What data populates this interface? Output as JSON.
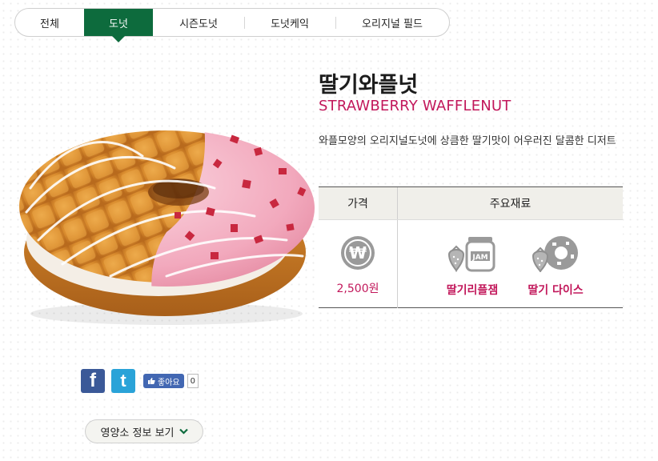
{
  "tabs": [
    {
      "label": "전체",
      "active": false
    },
    {
      "label": "도넛",
      "active": true
    },
    {
      "label": "시즌도넛",
      "active": false
    },
    {
      "label": "도넛케익",
      "active": false
    },
    {
      "label": "오리지널 필드",
      "active": false
    }
  ],
  "product": {
    "name_kr": "딸기와플넛",
    "name_en": "STRAWBERRY WAFFLENUT",
    "description": "와플모양의 오리지널도넛에 상큼한 딸기맛이 어우러진 달콤한 디저트"
  },
  "table": {
    "price_header": "가격",
    "ingredients_header": "주요재료",
    "price": "2,500원",
    "price_icon_symbol": "₩",
    "ingredients": [
      {
        "icon": "jam-jar-icon",
        "jar_label": "JAM",
        "label": "딸기리플잼"
      },
      {
        "icon": "strawberry-dice-icon",
        "label": "딸기 다이스"
      }
    ]
  },
  "social": {
    "facebook_glyph": "f",
    "twitter_glyph": "t",
    "like_label": "좋아요",
    "like_count": "0"
  },
  "nutrition_button": "영양소 정보 보기",
  "colors": {
    "brand_green": "#0d6b3d",
    "accent_pink": "#c2185b",
    "facebook": "#3b5998",
    "twitter": "#2aa3d8"
  }
}
